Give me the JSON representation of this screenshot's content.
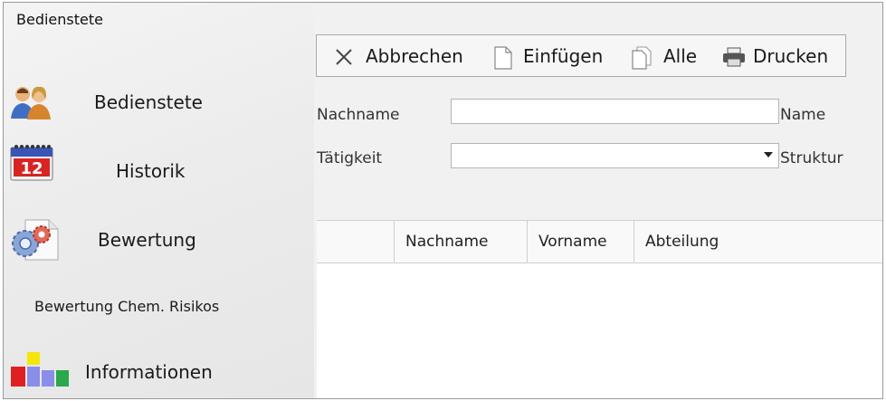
{
  "window": {
    "title": "Bedienstete"
  },
  "sidebar": {
    "items": [
      {
        "label": "Bedienstete",
        "icon": "people-icon"
      },
      {
        "label": "Historik",
        "icon": "calendar-icon",
        "icon_text": "12"
      },
      {
        "label": "Bewertung",
        "icon": "gears-icon"
      },
      {
        "label": "Bewertung Chem. Risikos"
      },
      {
        "label": "Informationen",
        "icon": "colored-blocks-icon"
      }
    ]
  },
  "toolbar": {
    "cancel_label": "Abbrechen",
    "insert_label": "Einfügen",
    "all_label": "Alle",
    "print_label": "Drucken"
  },
  "form": {
    "nachname_label": "Nachname",
    "nachname_value": "",
    "name_label": "Name",
    "taetigkeit_label": "Tätigkeit",
    "taetigkeit_value": "",
    "struktur_label": "Struktur"
  },
  "grid": {
    "columns": [
      "",
      "Nachname",
      "Vorname",
      "Abteilung"
    ],
    "rows": []
  },
  "colors": {
    "window_bg": "#f1f1f1",
    "border": "#9a9a9a",
    "grid_bg": "#ffffff",
    "info_red": "#e02020",
    "info_yellow": "#f5e60a",
    "info_blue": "#8a8ee8",
    "info_green": "#2aa84a"
  }
}
